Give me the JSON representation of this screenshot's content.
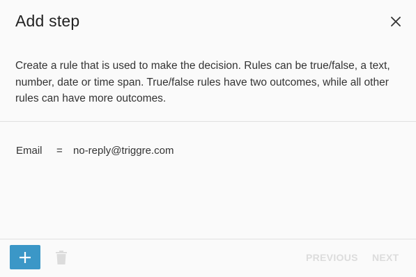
{
  "dialog": {
    "title": "Add step",
    "description": "Create a rule that is used to make the decision. Rules can be true/false, a text, number, date or time span. True/false rules have two outcomes, while all other rules can have more outcomes."
  },
  "rule": {
    "field": "Email",
    "operator": "=",
    "value": "no-reply@triggre.com"
  },
  "footer": {
    "previous_label": "PREVIOUS",
    "next_label": "NEXT"
  },
  "icons": {
    "close": "close-icon",
    "add": "plus-icon",
    "delete": "trash-icon"
  },
  "colors": {
    "accent": "#3b97c7",
    "disabled": "#dcdcdc"
  }
}
